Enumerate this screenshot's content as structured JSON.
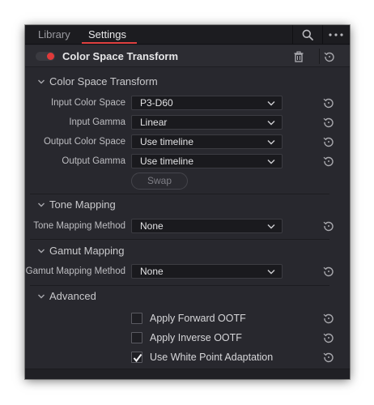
{
  "tabs": [
    {
      "label": "Library"
    },
    {
      "label": "Settings"
    }
  ],
  "toolbar": {
    "search_icon": "search-icon",
    "more_icon": "more-horizontal-icon"
  },
  "header": {
    "enabled": true,
    "title": "Color Space Transform",
    "delete_icon": "trash-icon",
    "reset_icon": "reset-icon",
    "accent_color": "#e03a3a"
  },
  "sections": {
    "cst": {
      "title": "Color Space Transform",
      "rows": [
        {
          "label": "Input Color Space",
          "value": "P3-D60"
        },
        {
          "label": "Input Gamma",
          "value": "Linear"
        },
        {
          "label": "Output Color Space",
          "value": "Use timeline"
        },
        {
          "label": "Output Gamma",
          "value": "Use timeline"
        }
      ],
      "swap_label": "Swap"
    },
    "tone": {
      "title": "Tone Mapping",
      "rows": [
        {
          "label": "Tone Mapping Method",
          "value": "None"
        }
      ]
    },
    "gamut": {
      "title": "Gamut Mapping",
      "rows": [
        {
          "label": "Gamut Mapping Method",
          "value": "None"
        }
      ]
    },
    "advanced": {
      "title": "Advanced",
      "options": [
        {
          "label": "Apply Forward OOTF",
          "checked": false
        },
        {
          "label": "Apply Inverse OOTF",
          "checked": false
        },
        {
          "label": "Use White Point Adaptation",
          "checked": true
        }
      ]
    }
  }
}
